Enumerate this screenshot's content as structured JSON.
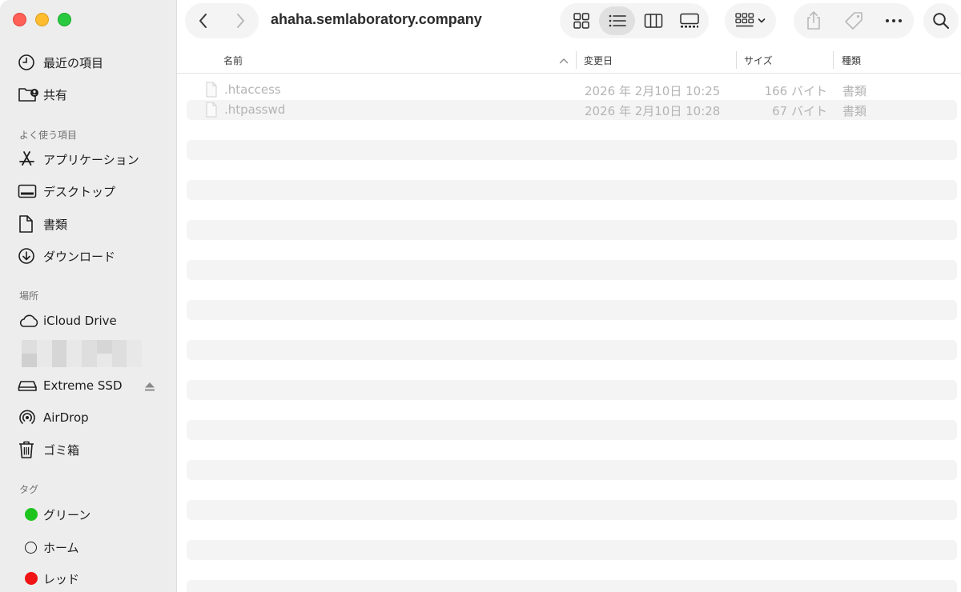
{
  "window": {
    "title": "ahaha.semlaboratory.company"
  },
  "sidebar": {
    "recent_label": "最近の項目",
    "shared_label": "共有",
    "favorites_header": "よく使う項目",
    "favorites": [
      {
        "label": "アプリケーション",
        "icon": "applications-icon"
      },
      {
        "label": "デスクトップ",
        "icon": "desktop-icon"
      },
      {
        "label": "書類",
        "icon": "document-icon"
      },
      {
        "label": "ダウンロード",
        "icon": "download-icon"
      }
    ],
    "locations_header": "場所",
    "locations": [
      {
        "label": "iCloud Drive",
        "icon": "cloud-icon"
      },
      {
        "label": "Extreme SSD",
        "icon": "drive-icon"
      },
      {
        "label": "AirDrop",
        "icon": "airdrop-icon"
      },
      {
        "label": "ゴミ箱",
        "icon": "trash-icon"
      }
    ],
    "tags_header": "タグ",
    "tags": [
      {
        "label": "グリーン",
        "color": "#1ec41e"
      },
      {
        "label": "ホーム",
        "color": "outline"
      },
      {
        "label": "レッド",
        "color": "#f01414"
      }
    ]
  },
  "columns": {
    "name": "名前",
    "modified": "変更日",
    "size": "サイズ",
    "kind": "種類"
  },
  "files": [
    {
      "name": ".htaccess",
      "modified": "2026 年 2月10日 10:25",
      "size": "166 バイト",
      "kind": "書類"
    },
    {
      "name": ".htpasswd",
      "modified": "2026 年 2月10日 10:28",
      "size": "67 バイト",
      "kind": "書類"
    }
  ],
  "colors": {
    "sidebar_bg": "#ededed",
    "row_stripe": "#f4f4f4",
    "dimmed_text": "#b4b4b4"
  }
}
